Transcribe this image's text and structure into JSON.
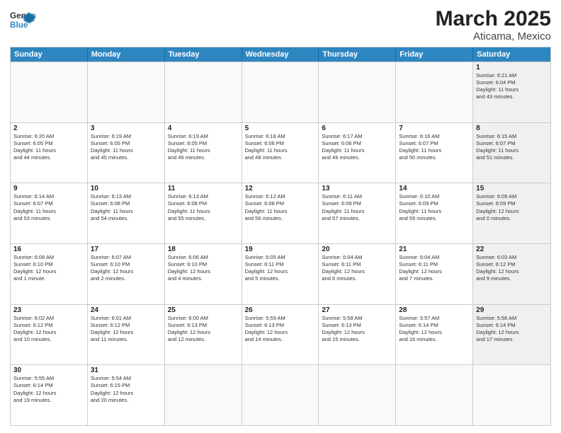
{
  "logo": {
    "text_general": "General",
    "text_blue": "Blue"
  },
  "title": "March 2025",
  "subtitle": "Aticama, Mexico",
  "days": [
    "Sunday",
    "Monday",
    "Tuesday",
    "Wednesday",
    "Thursday",
    "Friday",
    "Saturday"
  ],
  "weeks": [
    [
      {
        "day": "",
        "info": "",
        "empty": true
      },
      {
        "day": "",
        "info": "",
        "empty": true
      },
      {
        "day": "",
        "info": "",
        "empty": true
      },
      {
        "day": "",
        "info": "",
        "empty": true
      },
      {
        "day": "",
        "info": "",
        "empty": true
      },
      {
        "day": "",
        "info": "",
        "empty": true
      },
      {
        "day": "1",
        "info": "Sunrise: 6:21 AM\nSunset: 6:04 PM\nDaylight: 11 hours\nand 43 minutes.",
        "shaded": true
      }
    ],
    [
      {
        "day": "2",
        "info": "Sunrise: 6:20 AM\nSunset: 6:05 PM\nDaylight: 11 hours\nand 44 minutes."
      },
      {
        "day": "3",
        "info": "Sunrise: 6:19 AM\nSunset: 6:05 PM\nDaylight: 11 hours\nand 45 minutes."
      },
      {
        "day": "4",
        "info": "Sunrise: 6:19 AM\nSunset: 6:05 PM\nDaylight: 11 hours\nand 46 minutes."
      },
      {
        "day": "5",
        "info": "Sunrise: 6:18 AM\nSunset: 6:06 PM\nDaylight: 11 hours\nand 48 minutes."
      },
      {
        "day": "6",
        "info": "Sunrise: 6:17 AM\nSunset: 6:06 PM\nDaylight: 11 hours\nand 49 minutes."
      },
      {
        "day": "7",
        "info": "Sunrise: 6:16 AM\nSunset: 6:07 PM\nDaylight: 11 hours\nand 50 minutes."
      },
      {
        "day": "8",
        "info": "Sunrise: 6:15 AM\nSunset: 6:07 PM\nDaylight: 11 hours\nand 51 minutes.",
        "shaded": true
      }
    ],
    [
      {
        "day": "9",
        "info": "Sunrise: 6:14 AM\nSunset: 6:07 PM\nDaylight: 11 hours\nand 53 minutes."
      },
      {
        "day": "10",
        "info": "Sunrise: 6:13 AM\nSunset: 6:08 PM\nDaylight: 11 hours\nand 54 minutes."
      },
      {
        "day": "11",
        "info": "Sunrise: 6:13 AM\nSunset: 6:08 PM\nDaylight: 11 hours\nand 55 minutes."
      },
      {
        "day": "12",
        "info": "Sunrise: 6:12 AM\nSunset: 6:08 PM\nDaylight: 11 hours\nand 56 minutes."
      },
      {
        "day": "13",
        "info": "Sunrise: 6:11 AM\nSunset: 6:09 PM\nDaylight: 11 hours\nand 57 minutes."
      },
      {
        "day": "14",
        "info": "Sunrise: 6:10 AM\nSunset: 6:09 PM\nDaylight: 11 hours\nand 59 minutes."
      },
      {
        "day": "15",
        "info": "Sunrise: 6:09 AM\nSunset: 6:09 PM\nDaylight: 12 hours\nand 0 minutes.",
        "shaded": true
      }
    ],
    [
      {
        "day": "16",
        "info": "Sunrise: 6:08 AM\nSunset: 6:10 PM\nDaylight: 12 hours\nand 1 minute."
      },
      {
        "day": "17",
        "info": "Sunrise: 6:07 AM\nSunset: 6:10 PM\nDaylight: 12 hours\nand 2 minutes."
      },
      {
        "day": "18",
        "info": "Sunrise: 6:06 AM\nSunset: 6:10 PM\nDaylight: 12 hours\nand 4 minutes."
      },
      {
        "day": "19",
        "info": "Sunrise: 6:05 AM\nSunset: 6:11 PM\nDaylight: 12 hours\nand 5 minutes."
      },
      {
        "day": "20",
        "info": "Sunrise: 6:04 AM\nSunset: 6:11 PM\nDaylight: 12 hours\nand 6 minutes."
      },
      {
        "day": "21",
        "info": "Sunrise: 6:04 AM\nSunset: 6:11 PM\nDaylight: 12 hours\nand 7 minutes."
      },
      {
        "day": "22",
        "info": "Sunrise: 6:03 AM\nSunset: 6:12 PM\nDaylight: 12 hours\nand 9 minutes.",
        "shaded": true
      }
    ],
    [
      {
        "day": "23",
        "info": "Sunrise: 6:02 AM\nSunset: 6:12 PM\nDaylight: 12 hours\nand 10 minutes."
      },
      {
        "day": "24",
        "info": "Sunrise: 6:01 AM\nSunset: 6:12 PM\nDaylight: 12 hours\nand 11 minutes."
      },
      {
        "day": "25",
        "info": "Sunrise: 6:00 AM\nSunset: 6:13 PM\nDaylight: 12 hours\nand 12 minutes."
      },
      {
        "day": "26",
        "info": "Sunrise: 5:59 AM\nSunset: 6:13 PM\nDaylight: 12 hours\nand 14 minutes."
      },
      {
        "day": "27",
        "info": "Sunrise: 5:58 AM\nSunset: 6:13 PM\nDaylight: 12 hours\nand 15 minutes."
      },
      {
        "day": "28",
        "info": "Sunrise: 5:57 AM\nSunset: 6:14 PM\nDaylight: 12 hours\nand 16 minutes."
      },
      {
        "day": "29",
        "info": "Sunrise: 5:56 AM\nSunset: 6:14 PM\nDaylight: 12 hours\nand 17 minutes.",
        "shaded": true
      }
    ],
    [
      {
        "day": "30",
        "info": "Sunrise: 5:55 AM\nSunset: 6:14 PM\nDaylight: 12 hours\nand 19 minutes."
      },
      {
        "day": "31",
        "info": "Sunrise: 5:54 AM\nSunset: 6:15 PM\nDaylight: 12 hours\nand 20 minutes."
      },
      {
        "day": "",
        "info": "",
        "empty": true
      },
      {
        "day": "",
        "info": "",
        "empty": true
      },
      {
        "day": "",
        "info": "",
        "empty": true
      },
      {
        "day": "",
        "info": "",
        "empty": true
      },
      {
        "day": "",
        "info": "",
        "empty": true,
        "shaded": true
      }
    ]
  ]
}
